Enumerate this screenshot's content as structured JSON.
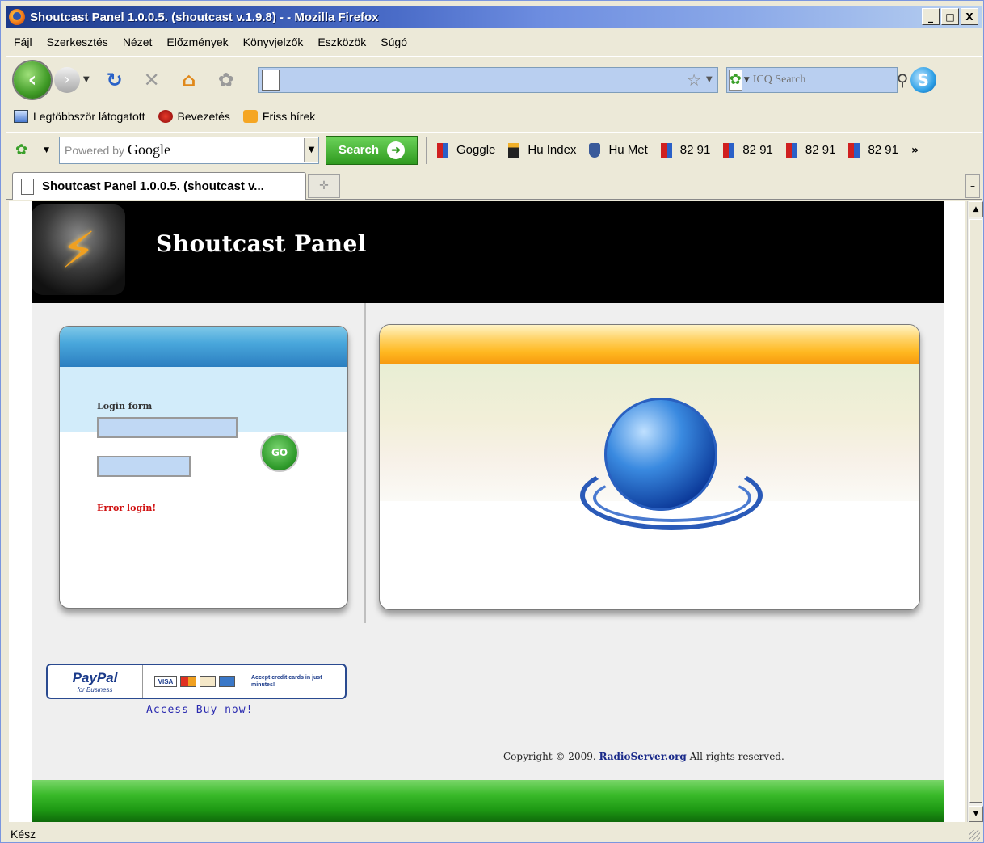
{
  "window": {
    "title": "Shoutcast Panel 1.0.0.5. (shoutcast v.1.9.8) - - Mozilla Firefox",
    "btn_min": "_",
    "btn_max": "□",
    "btn_close": "X"
  },
  "menu": [
    "Fájl",
    "Szerkesztés",
    "Nézet",
    "Előzmények",
    "Könyvjelzők",
    "Eszközök",
    "Súgó"
  ],
  "nav": {
    "address_value": "",
    "icq_placeholder": "ICQ Search"
  },
  "bookmarks": [
    "Legtöbbször látogatott",
    "Bevezetés",
    "Friss hírek"
  ],
  "google_toolbar": {
    "powered_text": "Powered by",
    "brand": "Google",
    "search_label": "Search",
    "links": [
      "Goggle",
      "Hu Index",
      "Hu Met",
      "82 91",
      "82 91",
      "82 91",
      "82 91"
    ],
    "more": "»"
  },
  "tab": {
    "label": "Shoutcast Panel 1.0.0.5. (shoutcast v...",
    "new_tab_glyph": "✛"
  },
  "page": {
    "site_title": "Shoutcast Panel",
    "login_label": "Login form",
    "go_label": "GO",
    "error_text": "Error login!",
    "paypal": {
      "brand": "PayPal",
      "sub": "for Business",
      "visa": "VISA",
      "accept": "Accept credit cards in just minutes!"
    },
    "buy_link": "Access Buy now!",
    "copyright_prefix": "Copyright © 2009.",
    "copyright_link": "RadioServer.org",
    "copyright_suffix": "All rights reserved."
  },
  "status": {
    "text": "Kész"
  },
  "colors": {
    "header_bg": "#000000",
    "footer_green": "#3aba2a",
    "error_red": "#d01010",
    "link_blue": "#2b2bb0"
  }
}
